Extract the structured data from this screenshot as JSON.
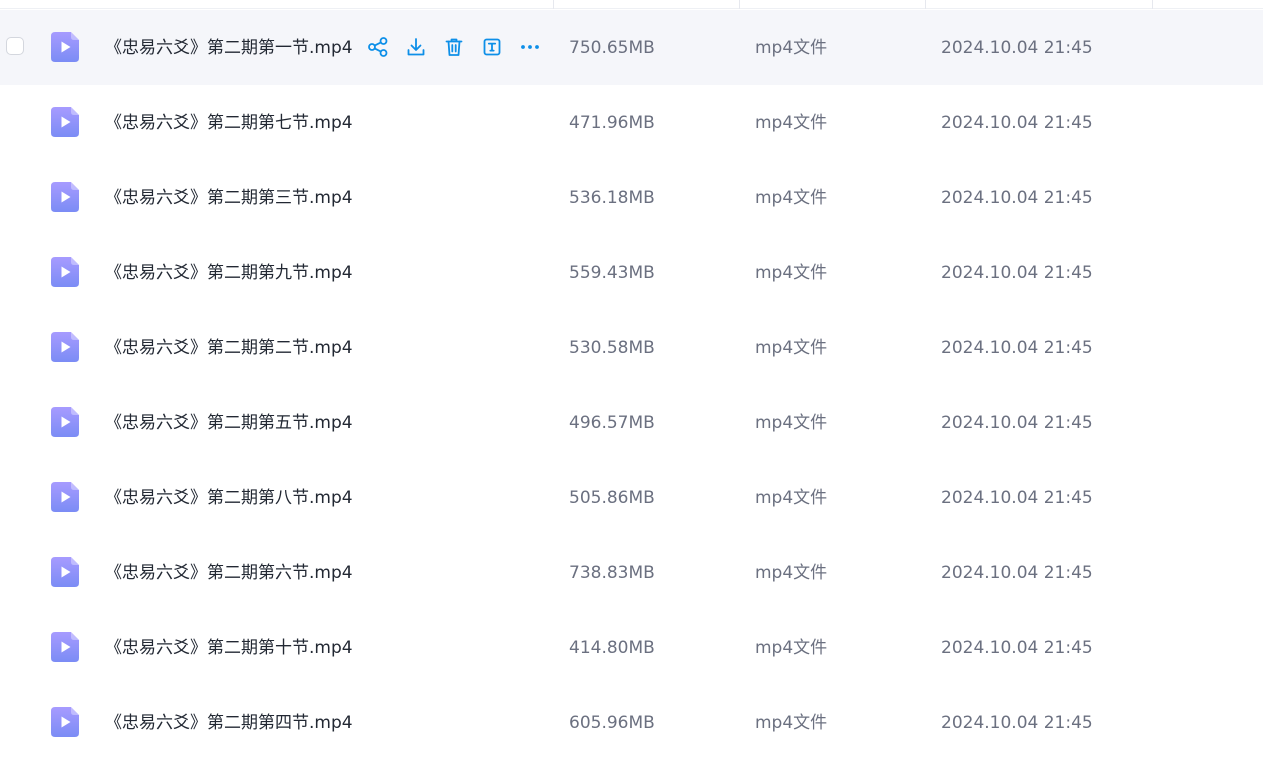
{
  "colors": {
    "accent": "#0d8fe8",
    "file_icon_top": "#a79bff",
    "file_icon_bottom": "#7b8cf5",
    "row_hover_bg": "#f5f6fa"
  },
  "row_actions": [
    {
      "name": "share-icon"
    },
    {
      "name": "download-icon"
    },
    {
      "name": "delete-icon"
    },
    {
      "name": "rename-icon"
    },
    {
      "name": "more-icon"
    }
  ],
  "files": [
    {
      "name": "《忠易六爻》第二期第一节.mp4",
      "size": "750.65MB",
      "type": "mp4文件",
      "time": "2024.10.04 21:45",
      "hovered": true
    },
    {
      "name": "《忠易六爻》第二期第七节.mp4",
      "size": "471.96MB",
      "type": "mp4文件",
      "time": "2024.10.04 21:45"
    },
    {
      "name": "《忠易六爻》第二期第三节.mp4",
      "size": "536.18MB",
      "type": "mp4文件",
      "time": "2024.10.04 21:45"
    },
    {
      "name": "《忠易六爻》第二期第九节.mp4",
      "size": "559.43MB",
      "type": "mp4文件",
      "time": "2024.10.04 21:45"
    },
    {
      "name": "《忠易六爻》第二期第二节.mp4",
      "size": "530.58MB",
      "type": "mp4文件",
      "time": "2024.10.04 21:45"
    },
    {
      "name": "《忠易六爻》第二期第五节.mp4",
      "size": "496.57MB",
      "type": "mp4文件",
      "time": "2024.10.04 21:45"
    },
    {
      "name": "《忠易六爻》第二期第八节.mp4",
      "size": "505.86MB",
      "type": "mp4文件",
      "time": "2024.10.04 21:45"
    },
    {
      "name": "《忠易六爻》第二期第六节.mp4",
      "size": "738.83MB",
      "type": "mp4文件",
      "time": "2024.10.04 21:45"
    },
    {
      "name": "《忠易六爻》第二期第十节.mp4",
      "size": "414.80MB",
      "type": "mp4文件",
      "time": "2024.10.04 21:45"
    },
    {
      "name": "《忠易六爻》第二期第四节.mp4",
      "size": "605.96MB",
      "type": "mp4文件",
      "time": "2024.10.04 21:45"
    }
  ]
}
